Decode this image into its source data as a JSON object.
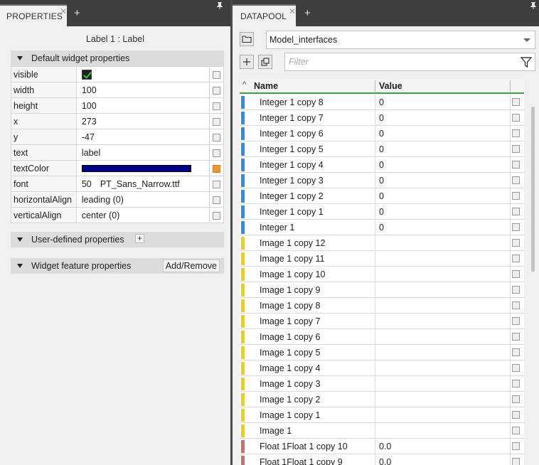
{
  "properties_panel": {
    "tab_label": "PROPERTIES",
    "widget_title": "Label 1 : Label",
    "default_section_title": "Default widget properties",
    "properties": [
      {
        "name": "visible",
        "value": "",
        "kind": "checkbox",
        "checked": true
      },
      {
        "name": "width",
        "value": "100",
        "kind": "text"
      },
      {
        "name": "height",
        "value": "100",
        "kind": "text"
      },
      {
        "name": "x",
        "value": "273",
        "kind": "text"
      },
      {
        "name": "y",
        "value": "-47",
        "kind": "text"
      },
      {
        "name": "text",
        "value": "label",
        "kind": "text"
      },
      {
        "name": "textColor",
        "value": "",
        "kind": "color",
        "color": "#00008b",
        "highlighted": true
      },
      {
        "name": "font",
        "value": "PT_Sans_Narrow.ttf",
        "font_size": "50",
        "kind": "font"
      },
      {
        "name": "horizontalAlign",
        "value": "leading (0)",
        "kind": "text"
      },
      {
        "name": "verticalAlign",
        "value": "center (0)",
        "kind": "text"
      }
    ],
    "user_section_title": "User-defined properties",
    "feature_section_title": "Widget feature properties",
    "add_remove_label": "Add/Remove"
  },
  "datapool_panel": {
    "tab_label": "DATAPOOL",
    "selected_interface": "Model_interfaces",
    "filter_placeholder": "Filter",
    "columns": {
      "name": "Name",
      "value": "Value"
    },
    "rows": [
      {
        "name": "Integer 1 copy 8",
        "value": "0",
        "type": "integer"
      },
      {
        "name": "Integer 1 copy 7",
        "value": "0",
        "type": "integer"
      },
      {
        "name": "Integer 1 copy 6",
        "value": "0",
        "type": "integer"
      },
      {
        "name": "Integer 1 copy 5",
        "value": "0",
        "type": "integer"
      },
      {
        "name": "Integer 1 copy 4",
        "value": "0",
        "type": "integer"
      },
      {
        "name": "Integer 1 copy 3",
        "value": "0",
        "type": "integer"
      },
      {
        "name": "Integer 1 copy 2",
        "value": "0",
        "type": "integer"
      },
      {
        "name": "Integer 1 copy 1",
        "value": "0",
        "type": "integer"
      },
      {
        "name": "Integer 1",
        "value": "0",
        "type": "integer"
      },
      {
        "name": "Image 1 copy 12",
        "value": "",
        "type": "image"
      },
      {
        "name": "Image 1 copy 11",
        "value": "",
        "type": "image"
      },
      {
        "name": "Image 1 copy 10",
        "value": "",
        "type": "image"
      },
      {
        "name": "Image 1 copy 9",
        "value": "",
        "type": "image"
      },
      {
        "name": "Image 1 copy 8",
        "value": "",
        "type": "image"
      },
      {
        "name": "Image 1 copy 7",
        "value": "",
        "type": "image"
      },
      {
        "name": "Image 1 copy 6",
        "value": "",
        "type": "image"
      },
      {
        "name": "Image 1 copy 5",
        "value": "",
        "type": "image"
      },
      {
        "name": "Image 1 copy 4",
        "value": "",
        "type": "image"
      },
      {
        "name": "Image 1 copy 3",
        "value": "",
        "type": "image"
      },
      {
        "name": "Image 1 copy 2",
        "value": "",
        "type": "image"
      },
      {
        "name": "Image 1 copy 1",
        "value": "",
        "type": "image"
      },
      {
        "name": "Image 1",
        "value": "",
        "type": "image"
      },
      {
        "name": "Float 1Float 1 copy 10",
        "value": "0.0",
        "type": "float"
      },
      {
        "name": "Float 1Float 1 copy 9",
        "value": "0.0",
        "type": "float"
      }
    ]
  },
  "colors": {
    "integer": "#2f8fe8",
    "image": "#f5cf00",
    "float": "#d46a6a",
    "header_underline": "#43a047",
    "highlight_checkbox": "#f0962d"
  },
  "icons": {
    "tab_close": "close-icon",
    "tab_add": "plus-icon",
    "pin": "pin-icon",
    "folder": "folder-icon",
    "add": "plus-icon",
    "duplicate": "duplicate-icon",
    "filter": "funnel-icon",
    "sort": "sort-ascending-icon",
    "dropdown": "chevron-down-icon"
  }
}
